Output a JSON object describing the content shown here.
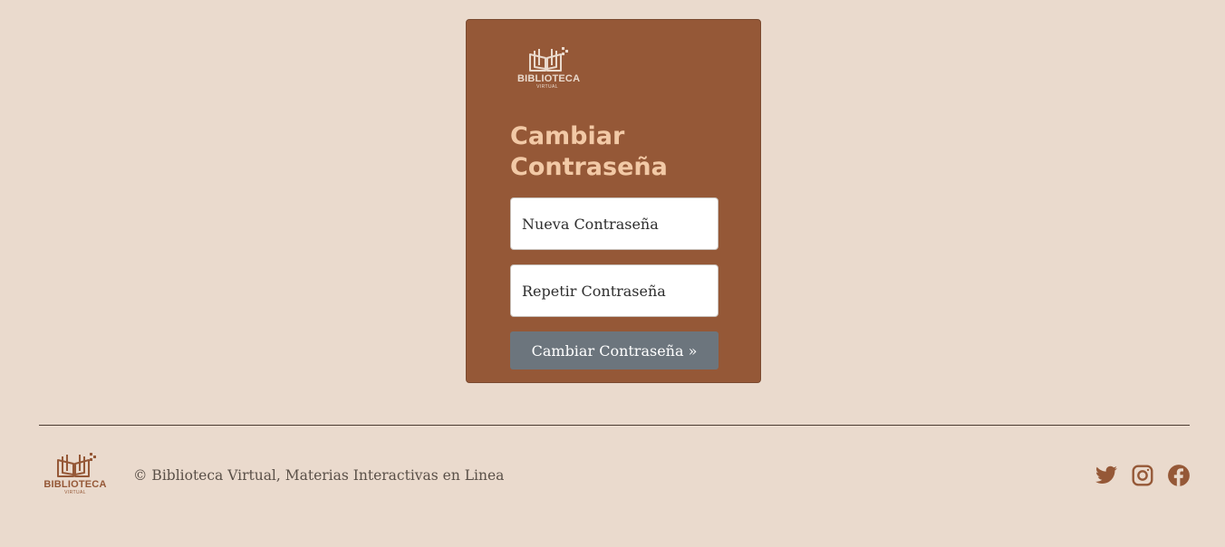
{
  "brand": {
    "name": "BIBLIOTECA",
    "subtitle": "VIRTUAL",
    "color_primary": "#955837",
    "color_background": "#eadacd",
    "color_title": "#f2c9a6"
  },
  "form": {
    "title": "Cambiar Contraseña",
    "new_password": {
      "placeholder": "Nueva Contraseña",
      "value": ""
    },
    "repeat_password": {
      "placeholder": "Repetir Contraseña",
      "value": ""
    },
    "submit_label": "Cambiar Contraseña »",
    "submit_color": "#6c757d"
  },
  "footer": {
    "copyright": "© Biblioteca Virtual, Materias Interactivas en Linea",
    "social": [
      {
        "icon": "twitter-icon"
      },
      {
        "icon": "instagram-icon"
      },
      {
        "icon": "facebook-icon"
      }
    ]
  }
}
